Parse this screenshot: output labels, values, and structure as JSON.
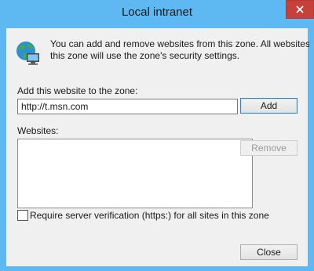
{
  "window": {
    "title": "Local intranet"
  },
  "info": {
    "line1": "You can add and remove websites from this zone. All websites in",
    "line2": "this zone will use the zone's security settings."
  },
  "add": {
    "label": "Add this website to the zone:",
    "value": "http://t.msn.com",
    "button": "Add"
  },
  "websites": {
    "label": "Websites:",
    "remove_button": "Remove"
  },
  "verification": {
    "label": "Require server verification (https:) for all sites in this zone",
    "checked": false
  },
  "footer": {
    "close_button": "Close"
  },
  "icons": {
    "zone": "globe-network-icon",
    "close": "close-icon"
  },
  "colors": {
    "titlebar": "#5eb8f1",
    "close_button": "#c7413a"
  }
}
